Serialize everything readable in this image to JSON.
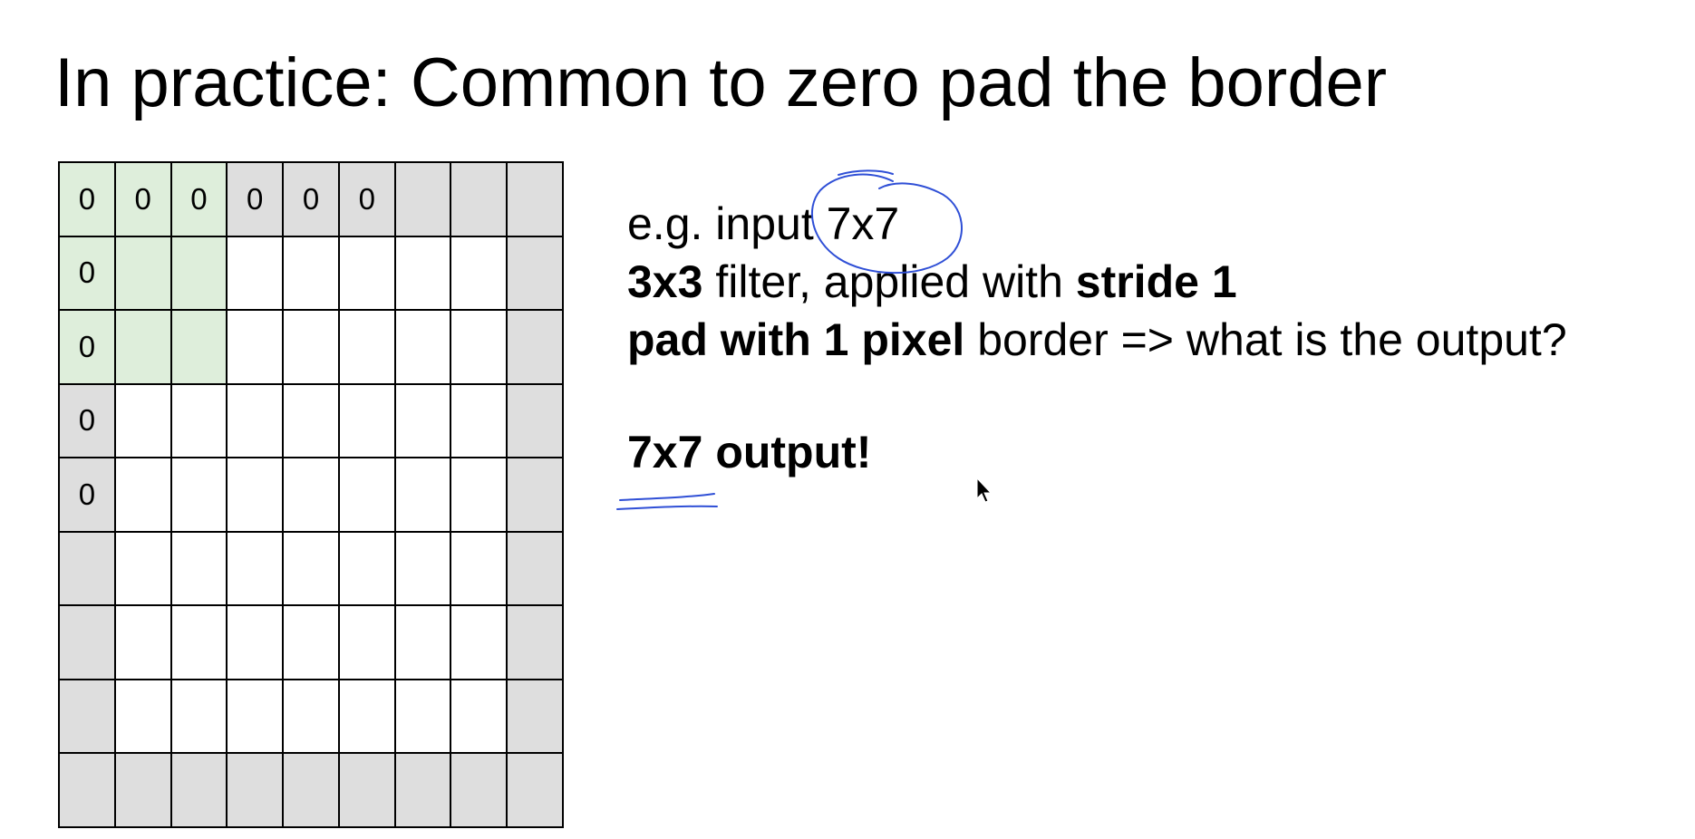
{
  "slide": {
    "title": "In practice: Common to zero pad the border"
  },
  "grid": {
    "rows": 9,
    "cols": 9,
    "cells": [
      [
        "0",
        "0",
        "0",
        "0",
        "0",
        "0",
        "",
        "",
        ""
      ],
      [
        "0",
        "",
        "",
        "",
        "",
        "",
        "",
        "",
        ""
      ],
      [
        "0",
        "",
        "",
        "",
        "",
        "",
        "",
        "",
        ""
      ],
      [
        "0",
        "",
        "",
        "",
        "",
        "",
        "",
        "",
        ""
      ],
      [
        "0",
        "",
        "",
        "",
        "",
        "",
        "",
        "",
        ""
      ],
      [
        "",
        "",
        "",
        "",
        "",
        "",
        "",
        "",
        ""
      ],
      [
        "",
        "",
        "",
        "",
        "",
        "",
        "",
        "",
        ""
      ],
      [
        "",
        "",
        "",
        "",
        "",
        "",
        "",
        "",
        ""
      ],
      [
        "",
        "",
        "",
        "",
        "",
        "",
        "",
        "",
        ""
      ]
    ],
    "filter_highlight": {
      "rows": [
        0,
        1,
        2
      ],
      "cols": [
        0,
        1,
        2
      ]
    },
    "colors": {
      "padding": "#dedede",
      "filter": "#deeedb",
      "input": "#ffffff",
      "lines": "#000000"
    }
  },
  "text": {
    "line1": "e.g. input 7x7",
    "line2_bold_a": "3x3",
    "line2_normal": " filter, applied with ",
    "line2_bold_b": "stride 1",
    "line3_bold": "pad with 1 pixel",
    "line3_normal": " border => what is the output?",
    "result": "7x7 output!"
  },
  "annotations": {
    "ink_color": "#2f4fd6",
    "marks": [
      "circle around 7x7",
      "underline under 7x7"
    ]
  }
}
